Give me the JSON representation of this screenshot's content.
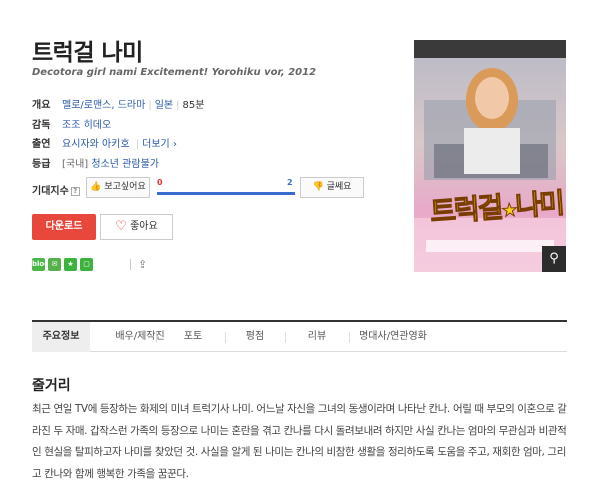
{
  "movie": {
    "title": "트럭걸 나미",
    "subtitle": "Decotora girl nami Excitement! Yorohiku vor, 2012"
  },
  "info": {
    "genre_label": "개요",
    "genre": "멜로/로맨스, 드라마",
    "country": "일본",
    "runtime": "85분",
    "director_label": "감독",
    "director": "조조 히데오",
    "cast_label": "출연",
    "cast": "요시자와 아키호",
    "more_label": "더보기",
    "rating_label": "등급",
    "rating_prefix": "[국내]",
    "rating": "청소년 관람불가"
  },
  "expectation": {
    "label": "기대지수",
    "want_label": "보고싶어요",
    "want_count": "0",
    "no_count": "2",
    "no_label": "글쎄요"
  },
  "actions": {
    "download_label": "다운로드",
    "like_label": "좋아요"
  },
  "socials": [
    "blog",
    "talk",
    "star",
    "square"
  ],
  "poster": {
    "title": "트럭걸",
    "star": "★",
    "title2": "나미"
  },
  "tabs": [
    "주요정보",
    "배우/제작진",
    "포토",
    "평점",
    "리뷰",
    "명대사/연관영화"
  ],
  "plot": {
    "title": "줄거리",
    "text": "최근 연일 TV에 등장하는 화제의 미녀 트럭기사 나미. 어느날 자신을 그녀의 동생이라며 나타난 칸나. 어릴 때 부모의 이혼으로 갈라진 두 자매. 갑작스런 가족의 등장으로 나미는 혼란을 겪고 칸나를 다시 돌려보내려 하지만 사실 칸나는 엄마의 무관심과 비관적인 현실을 탈피하고자 나미를 찾았던 것. 사실을 알게 된 나미는 칸나의 비참한 생활을 정리하도록 도움을 주고, 재회한 엄마, 그리고 칸나와 함께 행복한 가족을 꿈꾼다."
  },
  "colors": {
    "accent_red": "#e8483b",
    "link_blue": "#2a5aa8",
    "bar_blue": "#3a6ccf"
  }
}
